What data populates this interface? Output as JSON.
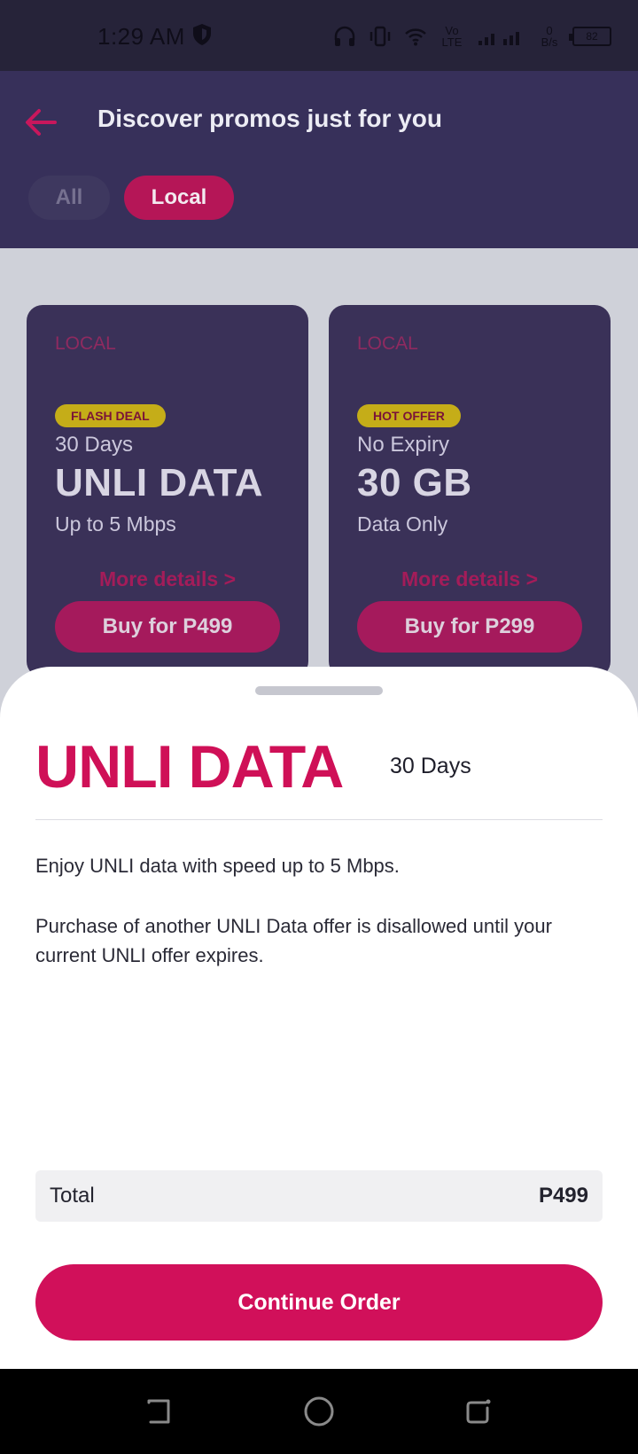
{
  "status_bar": {
    "time": "1:29 AM",
    "network_label": "Vo LTE",
    "speed": "0 B/s",
    "battery": "82"
  },
  "header": {
    "title": "Discover promos just for you",
    "filters": [
      "All",
      "Local"
    ],
    "active_filter": "Local"
  },
  "promos": [
    {
      "category": "LOCAL",
      "badge": "FLASH DEAL",
      "validity": "30 Days",
      "name": "UNLI DATA",
      "detail": "Up to 5 Mbps",
      "more_label": "More details >",
      "buy_label": "Buy for P499"
    },
    {
      "category": "LOCAL",
      "badge": "HOT OFFER",
      "validity": "No Expiry",
      "name": "30 GB",
      "detail": "Data Only",
      "more_label": "More details >",
      "buy_label": "Buy for P299"
    }
  ],
  "sheet": {
    "title": "UNLI DATA",
    "validity": "30 Days",
    "description_1": "Enjoy UNLI data with speed up to 5 Mbps.",
    "description_2": "Purchase of another UNLI Data offer is disallowed until your current UNLI offer expires.",
    "total_label": "Total",
    "total_value": "P499",
    "continue_label": "Continue Order"
  },
  "colors": {
    "brand_pink": "#d1105a",
    "header_bg": "#37305a",
    "card_bg": "#3a3158",
    "badge_yellow": "#c5ad18"
  },
  "icons": {
    "back": "arrow-left-icon",
    "nav": [
      "back-nav-icon",
      "home-nav-icon",
      "recent-apps-icon"
    ]
  }
}
